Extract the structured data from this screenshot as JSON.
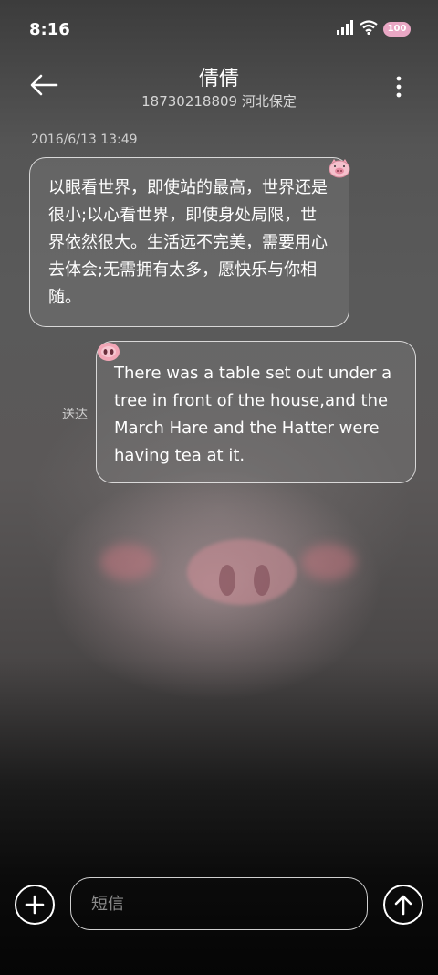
{
  "status_bar": {
    "time": "8:16",
    "battery": "100"
  },
  "header": {
    "contact_name": "倩倩",
    "contact_sub": "18730218809 河北保定"
  },
  "conversation": {
    "timestamp": "2016/6/13 13:49",
    "messages": [
      {
        "direction": "incoming",
        "text": "以眼看世界，即使站的最高，世界还是很小;以心看世界，即使身处局限，世界依然很大。生活远不完美，需要用心去体会;无需拥有太多，愿快乐与你相随。"
      },
      {
        "direction": "outgoing",
        "status": "送达",
        "text": "There was a table set out under a tree in front of the house,and the March Hare and the Hatter were having tea at it."
      }
    ]
  },
  "composer": {
    "placeholder": "短信"
  },
  "colors": {
    "accent": "#e9a7c4",
    "pig_pink": "#f2a6b6"
  }
}
